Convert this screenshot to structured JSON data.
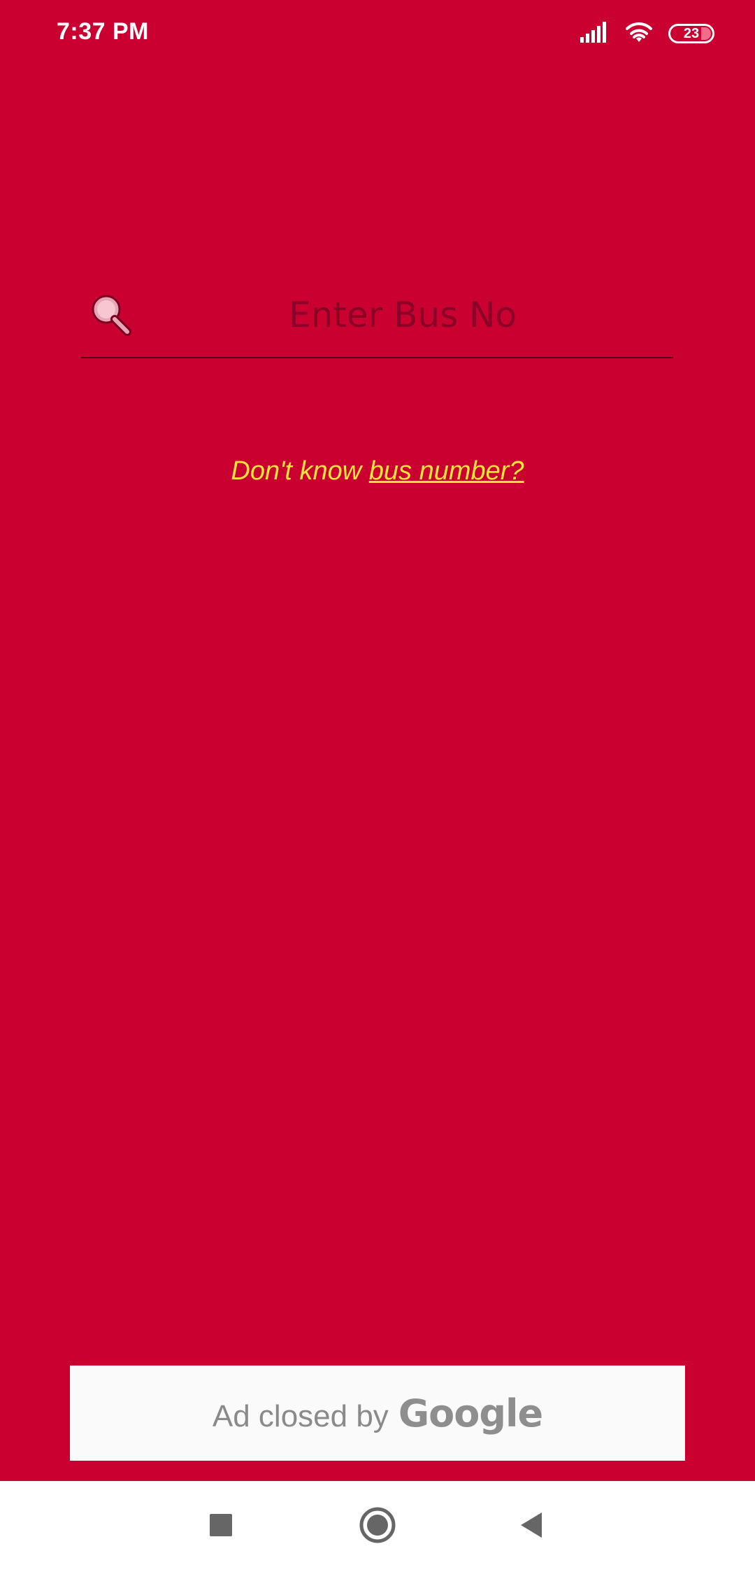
{
  "status_bar": {
    "time": "7:37 PM",
    "battery_level": "23",
    "icons": [
      "signal-icon",
      "wifi-icon",
      "battery-icon"
    ]
  },
  "search": {
    "placeholder": "Enter Bus No",
    "value": "",
    "icon": "search-icon"
  },
  "hint": {
    "prefix": "Don't know",
    "link_text": "bus number?"
  },
  "ad": {
    "text": "Ad closed by",
    "brand": "Google"
  },
  "nav_bar": {
    "icons": [
      "recents-icon",
      "home-icon",
      "back-icon"
    ]
  },
  "colors": {
    "background": "#ca0030",
    "hint": "#f7e23e",
    "ad_background": "#fafafa",
    "nav_background": "#ffffff"
  }
}
